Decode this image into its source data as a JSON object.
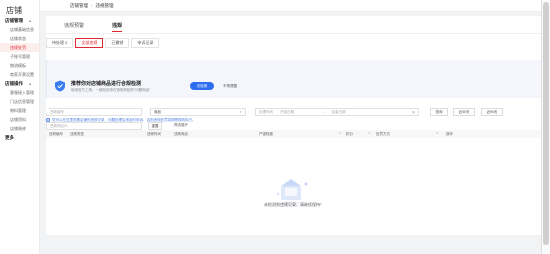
{
  "sidebar": {
    "logo": "店铺",
    "groups": [
      {
        "title": "店铺管理",
        "items": [
          "店铺基础信息",
          "店铺状态",
          "违规处罚",
          "子账号管理",
          "物流模板",
          "商家开票设置"
        ]
      },
      {
        "title": "店铺操作",
        "items": [
          "客服接入管理",
          "门店信息管理",
          "物料管理",
          "店铺资料",
          "店铺装修"
        ]
      },
      {
        "title": "更多",
        "items": []
      }
    ],
    "active_item": "违规处罚"
  },
  "breadcrumb": {
    "parent": "店铺管理",
    "current": "违规管理"
  },
  "main_tabs": [
    "违规预警",
    "违规"
  ],
  "active_main_tab": 1,
  "sub_tabs": [
    "待处理 0",
    "全部违规",
    "已撤销",
    "申诉记录"
  ],
  "active_sub_tab": 1,
  "banner": {
    "title": "推荐你对店铺商品进行合规检测",
    "subtitle": "使用官方工具，一键检查你在违规风险的“问题商品”",
    "primary_button": "去检测",
    "secondary_button": "不再提醒"
  },
  "filters": {
    "violation_id_placeholder": "违规编号",
    "type_placeholder": "违规类型",
    "type_value": "商品",
    "date_label": "处理时间",
    "date_start": "开始日期",
    "date_end": "结束日期",
    "btn_query": "查询",
    "btn_30d": "近30天",
    "btn_90d": "近90天",
    "product_id_placeholder": "违规商品ID",
    "btn_reset": "重置",
    "btn_more": "筛选展开"
  },
  "notice": "您可以在这里查看店铺的违规记录，问题处理后请及时申诉，否则违规处罚将按照规则执行。",
  "table": {
    "columns": [
      "违规编号",
      "违规类型",
      "违规时间",
      "违规商品",
      "严重程度",
      "扣分",
      "处罚方式",
      "操作"
    ]
  },
  "empty_state": "未检测到违规记录，请继续保持！"
}
